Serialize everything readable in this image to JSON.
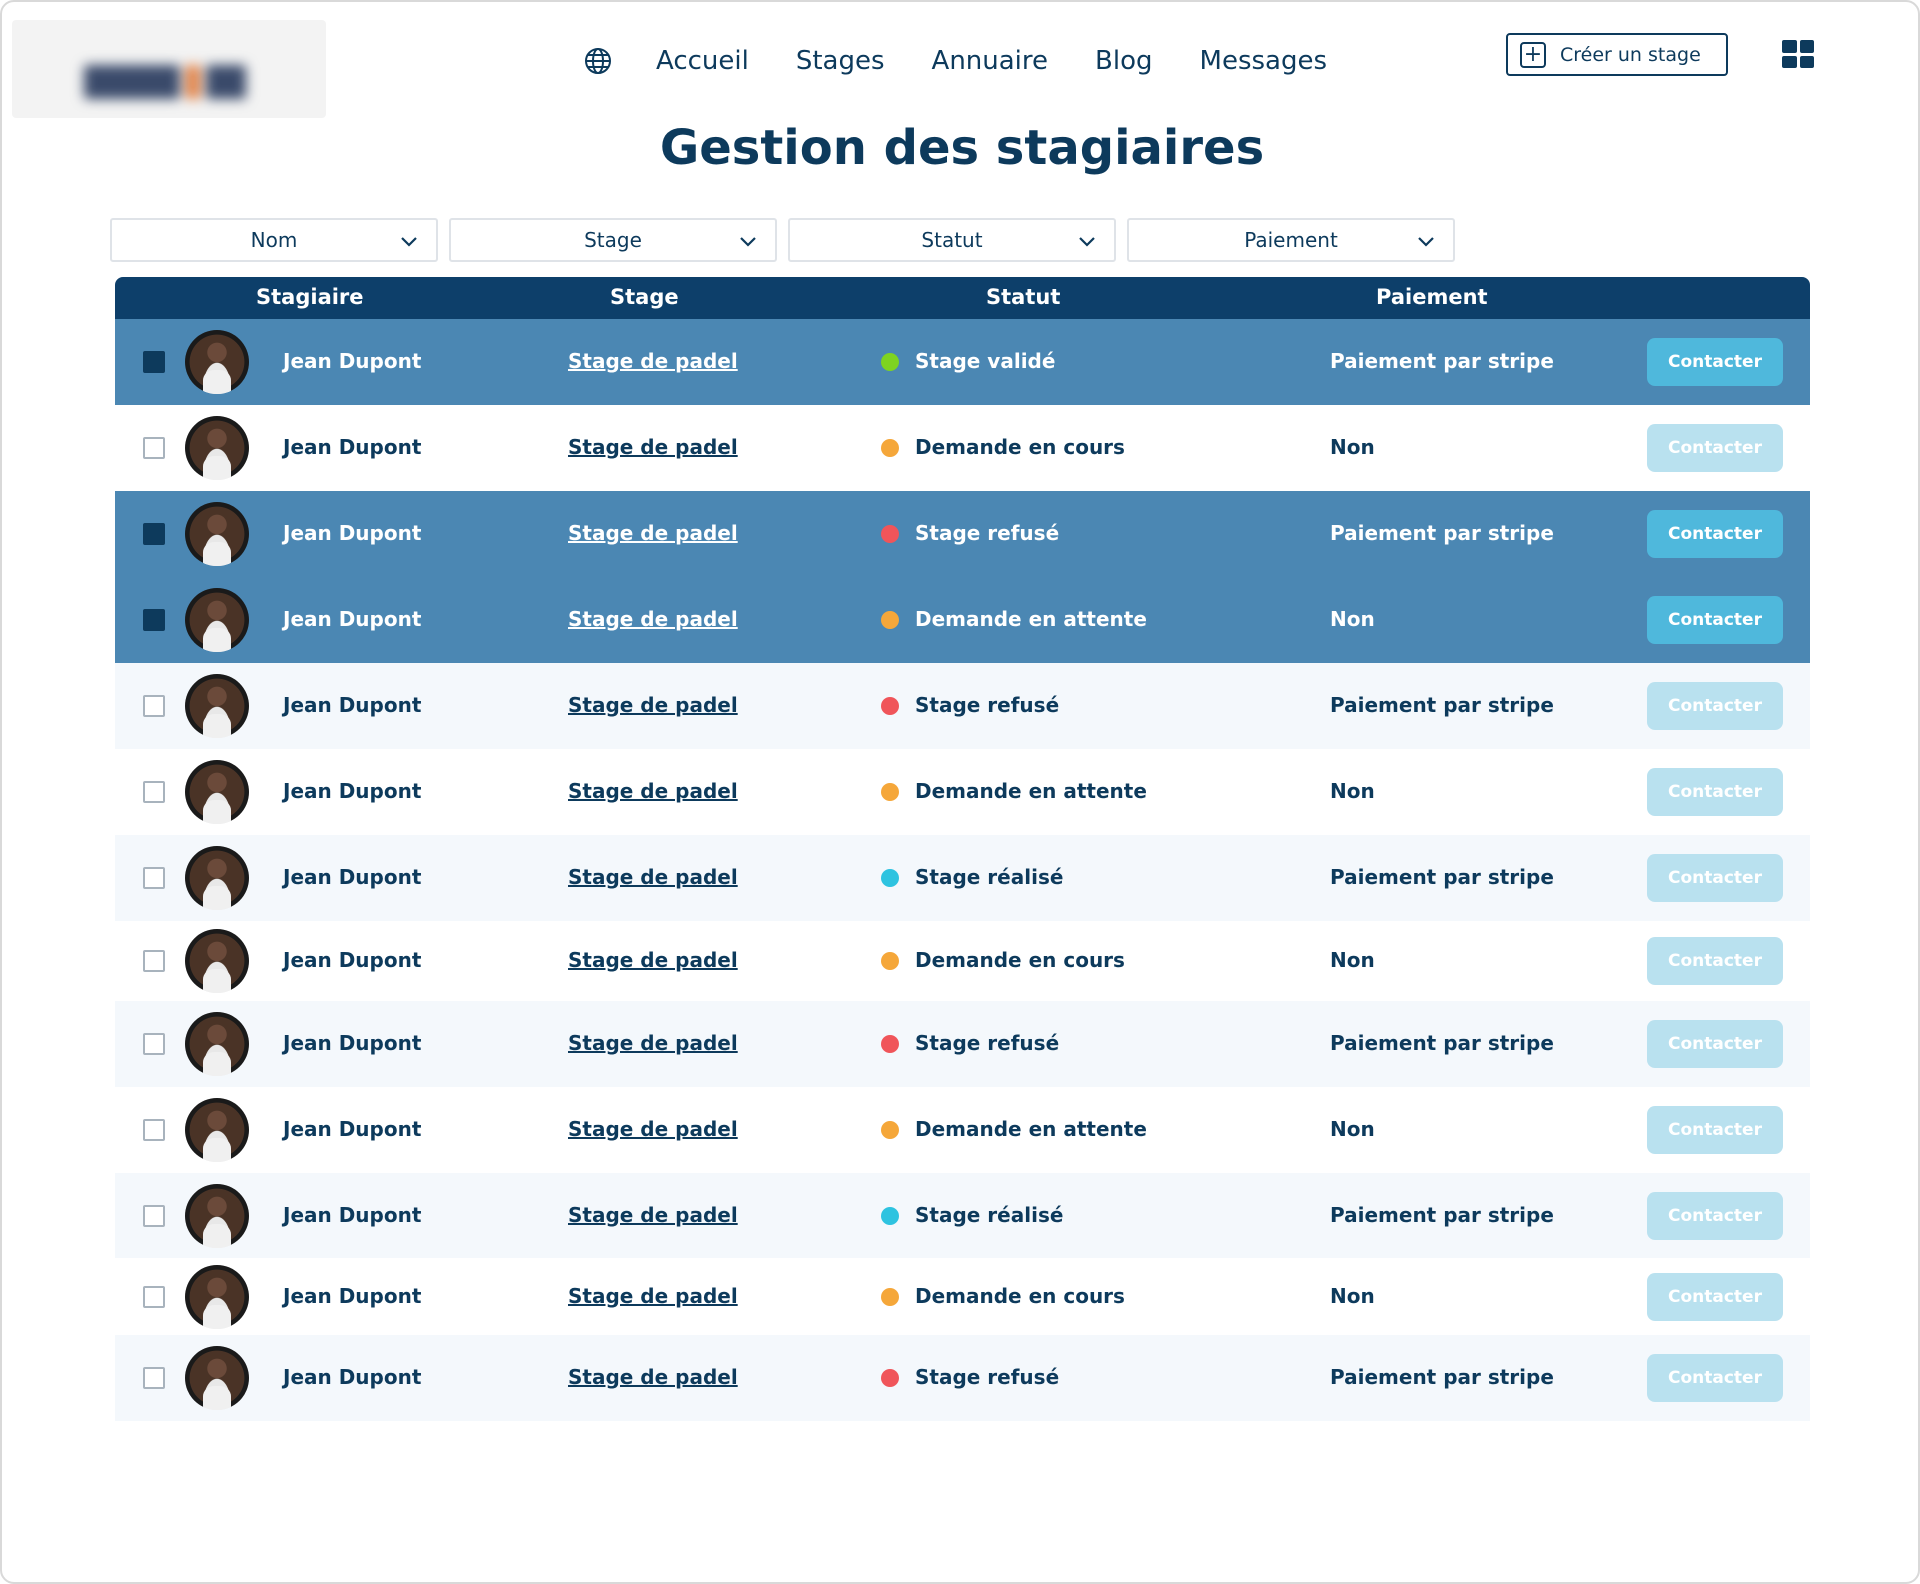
{
  "header": {
    "nav": [
      "Accueil",
      "Stages",
      "Annuaire",
      "Blog",
      "Messages"
    ],
    "create_label": "Créer un stage",
    "plus_glyph": "+"
  },
  "page_title": "Gestion des stagiaires",
  "filters": [
    "Nom",
    "Stage",
    "Statut",
    "Paiement"
  ],
  "table": {
    "headers": {
      "stagiaire": "Stagiaire",
      "stage": "Stage",
      "statut": "Statut",
      "paiement": "Paiement"
    },
    "contact_label": "Contacter",
    "rows": [
      {
        "name": "Jean Dupont",
        "stage": "Stage de padel",
        "status": "Stage validé",
        "status_color": "#7ed321",
        "payment": "Paiement par stripe",
        "selected": true
      },
      {
        "name": "Jean Dupont",
        "stage": "Stage de padel",
        "status": "Demande en cours",
        "status_color": "#f5a73a",
        "payment": "Non",
        "selected": false
      },
      {
        "name": "Jean Dupont",
        "stage": "Stage de padel",
        "status": "Stage refusé",
        "status_color": "#f0555a",
        "payment": "Paiement par stripe",
        "selected": true
      },
      {
        "name": "Jean Dupont",
        "stage": "Stage de padel",
        "status": "Demande en attente",
        "status_color": "#f5a73a",
        "payment": "Non",
        "selected": true
      },
      {
        "name": "Jean Dupont",
        "stage": "Stage de padel",
        "status": "Stage refusé",
        "status_color": "#f0555a",
        "payment": "Paiement par stripe",
        "selected": false
      },
      {
        "name": "Jean Dupont",
        "stage": "Stage de padel",
        "status": "Demande en attente",
        "status_color": "#f5a73a",
        "payment": "Non",
        "selected": false
      },
      {
        "name": "Jean Dupont",
        "stage": "Stage de padel",
        "status": "Stage réalisé",
        "status_color": "#2ec3e0",
        "payment": "Paiement par stripe",
        "selected": false
      },
      {
        "name": "Jean Dupont",
        "stage": "Stage de padel",
        "status": "Demande en cours",
        "status_color": "#f5a73a",
        "payment": "Non",
        "selected": false
      },
      {
        "name": "Jean Dupont",
        "stage": "Stage de padel",
        "status": "Stage refusé",
        "status_color": "#f0555a",
        "payment": "Paiement par stripe",
        "selected": false
      },
      {
        "name": "Jean Dupont",
        "stage": "Stage de padel",
        "status": "Demande en attente",
        "status_color": "#f5a73a",
        "payment": "Non",
        "selected": false
      },
      {
        "name": "Jean Dupont",
        "stage": "Stage de padel",
        "status": "Stage réalisé",
        "status_color": "#2ec3e0",
        "payment": "Paiement par stripe",
        "selected": false
      },
      {
        "name": "Jean Dupont",
        "stage": "Stage de padel",
        "status": "Demande en cours",
        "status_color": "#f5a73a",
        "payment": "Non",
        "selected": false
      },
      {
        "name": "Jean Dupont",
        "stage": "Stage de padel",
        "status": "Stage refusé",
        "status_color": "#f0555a",
        "payment": "Paiement par stripe",
        "selected": false
      }
    ]
  },
  "colors": {
    "primary": "#0d3a5c",
    "header_bg": "#0d3f6a",
    "selected_row": "#4b87b3",
    "contact_active": "#4fb8dc",
    "contact_inactive": "#b9e1ef"
  }
}
